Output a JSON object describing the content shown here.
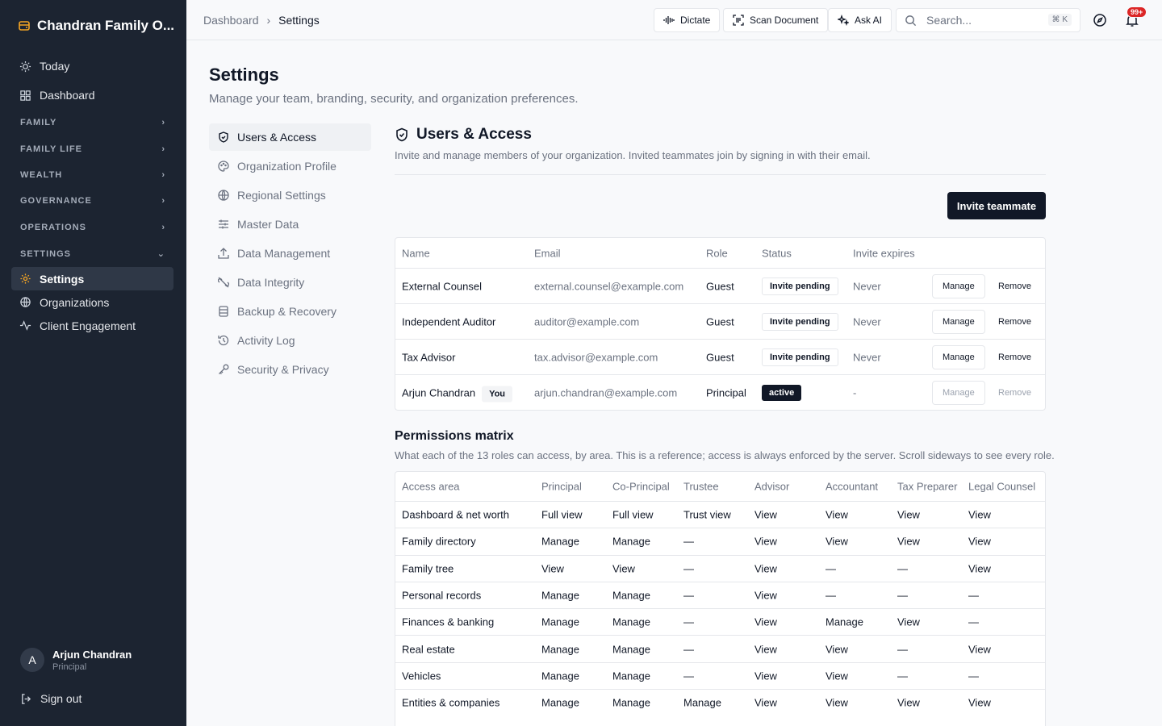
{
  "sidebar": {
    "brand": "Chandran Family O...",
    "top_items": [
      {
        "label": "Today",
        "icon": "sun-icon"
      },
      {
        "label": "Dashboard",
        "icon": "grid-icon"
      }
    ],
    "groups": [
      "FAMILY",
      "FAMILY LIFE",
      "WEALTH",
      "GOVERNANCE",
      "OPERATIONS",
      "SETTINGS"
    ],
    "settings_items": [
      {
        "label": "Settings",
        "icon": "gear-icon",
        "active": true
      },
      {
        "label": "Organizations",
        "icon": "globe-icon"
      },
      {
        "label": "Client Engagement",
        "icon": "activity-icon"
      }
    ],
    "user": {
      "initial": "A",
      "name": "Arjun Chandran",
      "role": "Principal"
    },
    "signout": "Sign out"
  },
  "topbar": {
    "breadcrumb": [
      "Dashboard",
      "Settings"
    ],
    "dictate": "Dictate",
    "scan": "Scan Document",
    "ask_ai": "Ask AI",
    "search_placeholder": "Search...",
    "search_shortcut": "⌘ K",
    "notifications": "99+"
  },
  "page": {
    "title": "Settings",
    "subtitle": "Manage your team, branding, security, and organization preferences."
  },
  "subnav": [
    {
      "label": "Users & Access",
      "icon": "shield-icon",
      "active": true
    },
    {
      "label": "Organization Profile",
      "icon": "palette-icon"
    },
    {
      "label": "Regional Settings",
      "icon": "globe-icon"
    },
    {
      "label": "Master Data",
      "icon": "sliders-icon"
    },
    {
      "label": "Data Management",
      "icon": "upload-icon"
    },
    {
      "label": "Data Integrity",
      "icon": "unlink-icon"
    },
    {
      "label": "Backup & Recovery",
      "icon": "database-icon"
    },
    {
      "label": "Activity Log",
      "icon": "history-icon"
    },
    {
      "label": "Security & Privacy",
      "icon": "key-icon"
    }
  ],
  "section": {
    "title": "Users & Access",
    "description": "Invite and manage members of your organization. Invited teammates join by signing in with their email.",
    "invite_button": "Invite teammate"
  },
  "users_table": {
    "headers": [
      "Name",
      "Email",
      "Role",
      "Status",
      "Invite expires"
    ],
    "rows": [
      {
        "name": "External Counsel",
        "email": "external.counsel@example.com",
        "role": "Guest",
        "status": "Invite pending",
        "expires": "Never",
        "manage": "Manage",
        "remove": "Remove"
      },
      {
        "name": "Independent Auditor",
        "email": "auditor@example.com",
        "role": "Guest",
        "status": "Invite pending",
        "expires": "Never",
        "manage": "Manage",
        "remove": "Remove"
      },
      {
        "name": "Tax Advisor",
        "email": "tax.advisor@example.com",
        "role": "Guest",
        "status": "Invite pending",
        "expires": "Never",
        "manage": "Manage",
        "remove": "Remove"
      },
      {
        "name": "Arjun Chandran",
        "you": "You",
        "email": "arjun.chandran@example.com",
        "role": "Principal",
        "status": "active",
        "expires": "-",
        "manage": "Manage",
        "remove": "Remove"
      }
    ]
  },
  "permissions": {
    "title": "Permissions matrix",
    "description": "What each of the 13 roles can access, by area. This is a reference; access is always enforced by the server. Scroll sideways to see every role.",
    "headers": [
      "Access area",
      "Principal",
      "Co-Principal",
      "Trustee",
      "Advisor",
      "Accountant",
      "Tax Preparer",
      "Legal Counsel"
    ],
    "rows": [
      [
        "Dashboard & net worth",
        "Full view",
        "Full view",
        "Trust view",
        "View",
        "View",
        "View",
        "View"
      ],
      [
        "Family directory",
        "Manage",
        "Manage",
        "—",
        "View",
        "View",
        "View",
        "View"
      ],
      [
        "Family tree",
        "View",
        "View",
        "—",
        "View",
        "—",
        "—",
        "View"
      ],
      [
        "Personal records",
        "Manage",
        "Manage",
        "—",
        "View",
        "—",
        "—",
        "—"
      ],
      [
        "Finances & banking",
        "Manage",
        "Manage",
        "—",
        "View",
        "Manage",
        "View",
        "—"
      ],
      [
        "Real estate",
        "Manage",
        "Manage",
        "—",
        "View",
        "View",
        "—",
        "View"
      ],
      [
        "Vehicles",
        "Manage",
        "Manage",
        "—",
        "View",
        "View",
        "—",
        "—"
      ],
      [
        "Entities & companies",
        "Manage",
        "Manage",
        "Manage",
        "View",
        "View",
        "View",
        "View"
      ]
    ]
  }
}
